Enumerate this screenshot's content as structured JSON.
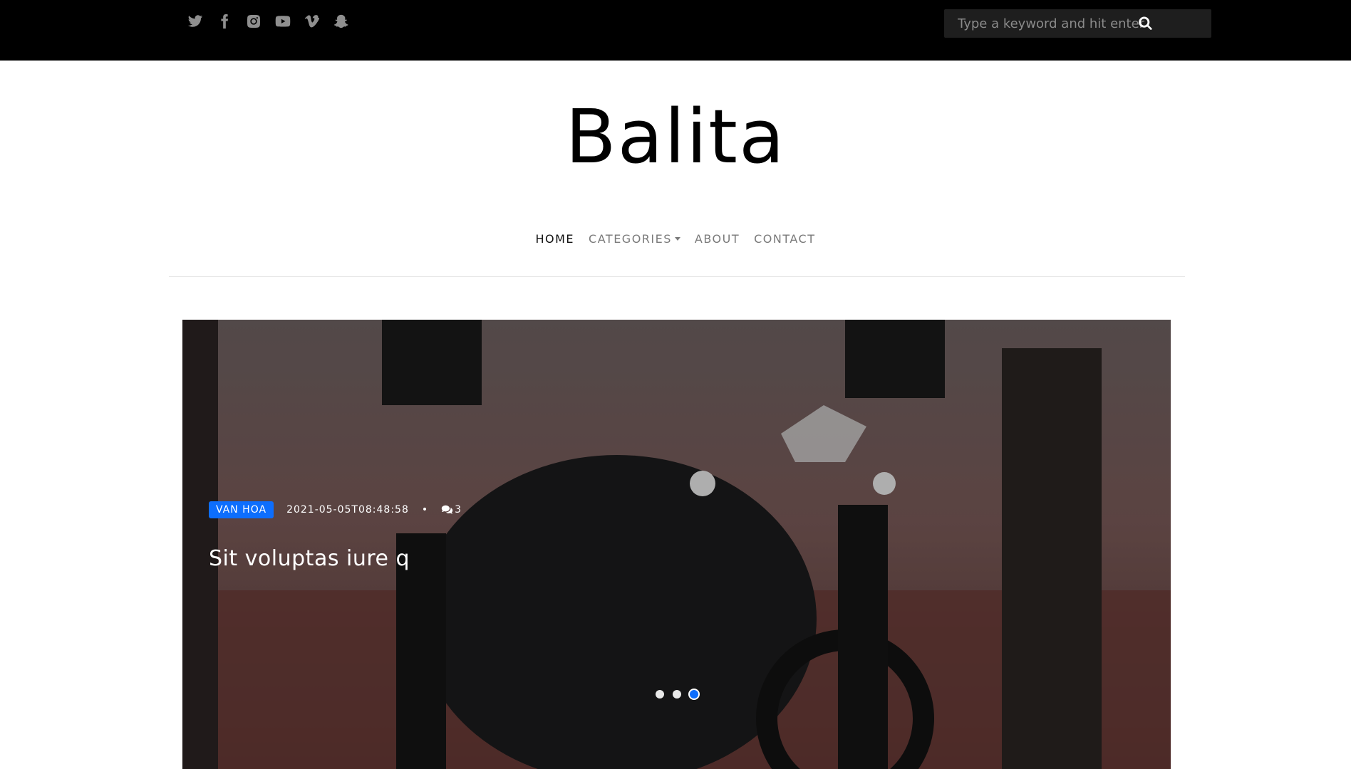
{
  "social": {
    "icons": [
      "twitter-icon",
      "facebook-icon",
      "instagram-icon",
      "youtube-icon",
      "vimeo-icon",
      "snapchat-icon"
    ]
  },
  "search": {
    "placeholder": "Type a keyword and hit enter"
  },
  "site": {
    "logo": "Balita"
  },
  "nav": {
    "items": [
      {
        "label": "HOME",
        "active": true
      },
      {
        "label": "CATEGORIES",
        "dropdown": true
      },
      {
        "label": "ABOUT"
      },
      {
        "label": "CONTACT"
      }
    ]
  },
  "hero": {
    "category": "VAN HOA",
    "date": "2021-05-05T08:48:58",
    "separator": "•",
    "comments": "3",
    "title": "Sit voluptas iure q",
    "slides_count": 3,
    "active_slide": 3
  },
  "colors": {
    "topbar": "#000000",
    "accent": "#0d6efd"
  }
}
